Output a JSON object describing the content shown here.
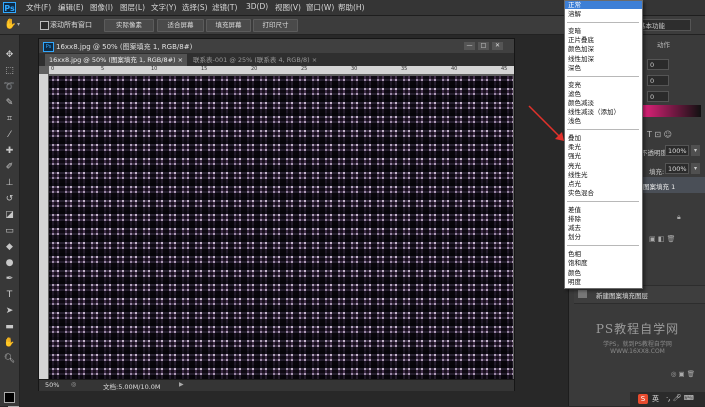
{
  "app": {
    "logo": "Ps"
  },
  "menubar": {
    "items": [
      "文件(F)",
      "编辑(E)",
      "图像(I)",
      "图层(L)",
      "文字(Y)",
      "选择(S)",
      "滤镜(T)",
      "3D(D)",
      "视图(V)",
      "窗口(W)",
      "帮助(H)"
    ]
  },
  "options": {
    "scroll_all_label": "滚动所有窗口",
    "actual_pixels": "实际像素",
    "fit_screen": "适合屏幕",
    "fill_screen": "填充屏幕",
    "print_size": "打印尺寸",
    "workspace": "基本功能"
  },
  "document": {
    "tab_active": "16xx8.jpg @ 50% (图案填充 1, RGB/8#) ×",
    "tab_inactive": "联系表-001 @ 25% (联系表 4, RGB/8) ×",
    "titlebar": "16xx8.jpg @ 50% (图案填充 1, RGB/8#)",
    "zoom": "50%",
    "doc_info": "文档:5.00M/10.0M",
    "ruler_marks": [
      "0",
      "5",
      "10",
      "15",
      "20",
      "25",
      "30",
      "35",
      "40",
      "45"
    ]
  },
  "panels": {
    "tab_label": "动作",
    "fields": [
      "0",
      "0",
      "0"
    ],
    "opacity_label": "不透明度:",
    "opacity_value": "100%",
    "fill_label": "填充:",
    "fill_value": "100%",
    "layer_name": "图案填充 1",
    "history_item": "新建图案填充图层"
  },
  "watermark": {
    "title": "PS教程自学网",
    "subtitle": "学PS，就到PS教程自学网",
    "url": "WWW.16XX8.COM"
  },
  "tray": {
    "ime": "英"
  },
  "blend_menu": {
    "groups": [
      [
        "正常",
        "溶解"
      ],
      [
        "变暗",
        "正片叠底",
        "颜色加深",
        "线性加深",
        "深色"
      ],
      [
        "变亮",
        "滤色",
        "颜色减淡",
        "线性减淡（添加）",
        "浅色"
      ],
      [
        "叠加",
        "柔光",
        "强光",
        "亮光",
        "线性光",
        "点光",
        "实色混合"
      ],
      [
        "差值",
        "排除",
        "减去",
        "划分"
      ],
      [
        "色相",
        "饱和度",
        "颜色",
        "明度"
      ]
    ]
  },
  "colors": {
    "accent": "#3d7fd6",
    "arrow": "#e0312b"
  }
}
